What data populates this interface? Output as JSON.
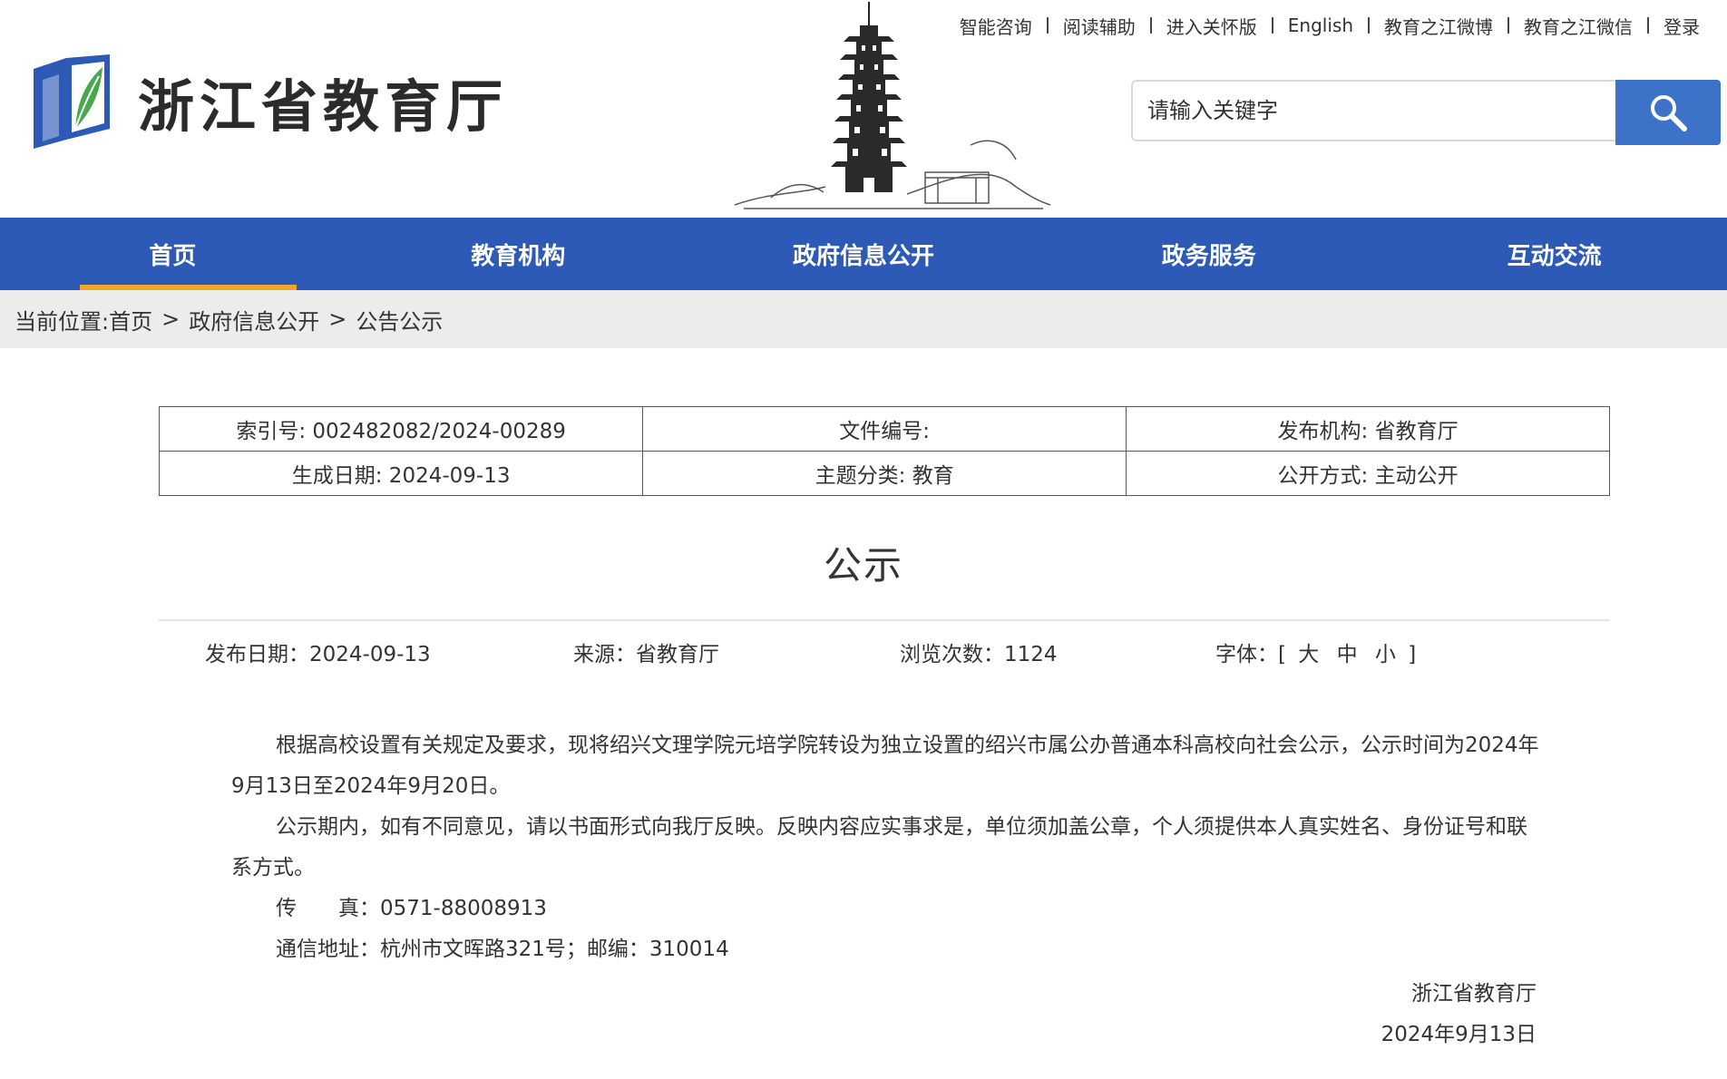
{
  "header": {
    "site_title": "浙江省教育厅",
    "toplinks": [
      "智能咨询",
      "阅读辅助",
      "进入关怀版",
      "English",
      "教育之江微博",
      "教育之江微信",
      "登录"
    ],
    "search_placeholder": "请输入关键字"
  },
  "nav": {
    "items": [
      "首页",
      "教育机构",
      "政府信息公开",
      "政务服务",
      "互动交流"
    ],
    "active": "首页"
  },
  "breadcrumb": {
    "prefix": "当前位置:",
    "items": [
      "首页",
      "政府信息公开",
      "公告公示"
    ],
    "separator": ">"
  },
  "meta": {
    "index_no": "索引号: 002482082/2024-00289",
    "doc_no": "文件编号:",
    "publisher": "发布机构: 省教育厅",
    "created": "生成日期: 2024-09-13",
    "topic": "主题分类: 教育",
    "disclosure": "公开方式: 主动公开"
  },
  "article": {
    "title": "公示",
    "publish_date": "发布日期：2024-09-13",
    "source": "来源：省教育厅",
    "views": "浏览次数：1124",
    "font_label": "字体：[",
    "font_sizes": [
      "大",
      "中",
      "小"
    ],
    "font_close": "]",
    "paragraphs": [
      "根据高校设置有关规定及要求，现将绍兴文理学院元培学院转设为独立设置的绍兴市属公办普通本科高校向社会公示，公示时间为2024年9月13日至2024年9月20日。",
      "公示期内，如有不同意见，请以书面形式向我厅反映。反映内容应实事求是，单位须加盖公章，个人须提供本人真实姓名、身份证号和联系方式。",
      "传　　真：0571-88008913",
      "通信地址：杭州市文晖路321号；邮编：310014"
    ],
    "signature_org": "浙江省教育厅",
    "signature_date": "2024年9月13日"
  },
  "colors": {
    "nav_bg": "#2d5ab6",
    "nav_active_underline": "#f2a72a",
    "search_button": "#3c73c9",
    "breadcrumb_bg": "#ececec"
  },
  "icons": [
    "emblem-logo",
    "pagoda-illustration",
    "search-icon"
  ]
}
